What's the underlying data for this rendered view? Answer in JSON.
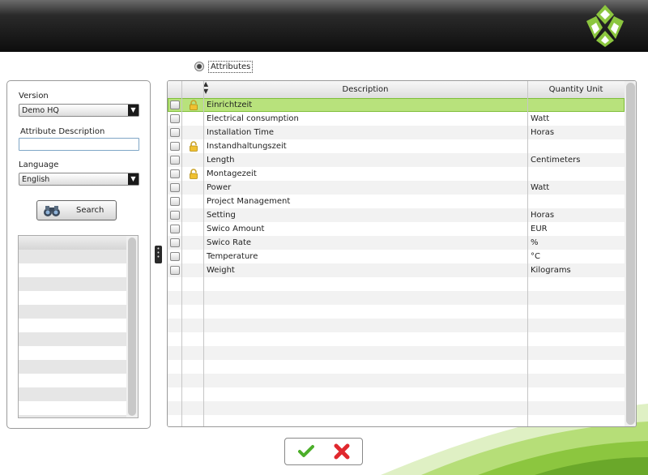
{
  "header": {
    "brand_color": "#8cc63f"
  },
  "mode": {
    "label": "Attributes",
    "selected": true
  },
  "filters": {
    "version_label": "Version",
    "version_value": "Demo HQ",
    "attribute_description_label": "Attribute Description",
    "attribute_description_value": "",
    "language_label": "Language",
    "language_value": "English",
    "search_label": "Search"
  },
  "grid": {
    "columns": {
      "description": "Description",
      "unit": "Quantity Unit"
    },
    "rows": [
      {
        "description": "Einrichtzeit",
        "unit": "",
        "locked": true,
        "selected": true
      },
      {
        "description": "Electrical consumption",
        "unit": "Watt",
        "locked": false
      },
      {
        "description": "Installation Time",
        "unit": "Horas",
        "locked": false
      },
      {
        "description": "Instandhaltungszeit",
        "unit": "",
        "locked": true
      },
      {
        "description": "Length",
        "unit": "Centimeters",
        "locked": false
      },
      {
        "description": "Montagezeit",
        "unit": "",
        "locked": true
      },
      {
        "description": "Power",
        "unit": "Watt",
        "locked": false
      },
      {
        "description": "Project Management",
        "unit": "",
        "locked": false
      },
      {
        "description": "Setting",
        "unit": "Horas",
        "locked": false
      },
      {
        "description": "Swico Amount",
        "unit": "EUR",
        "locked": false
      },
      {
        "description": "Swico Rate",
        "unit": "%",
        "locked": false
      },
      {
        "description": "Temperature",
        "unit": "°C",
        "locked": false
      },
      {
        "description": "Weight",
        "unit": "Kilograms",
        "locked": false
      }
    ]
  },
  "actions": {
    "ok_icon": "green-check-icon",
    "cancel_icon": "red-x-icon"
  },
  "colors": {
    "selected_row": "#b8e27c",
    "header_bg": "#1a1a1a",
    "accent": "#8cc63f"
  }
}
